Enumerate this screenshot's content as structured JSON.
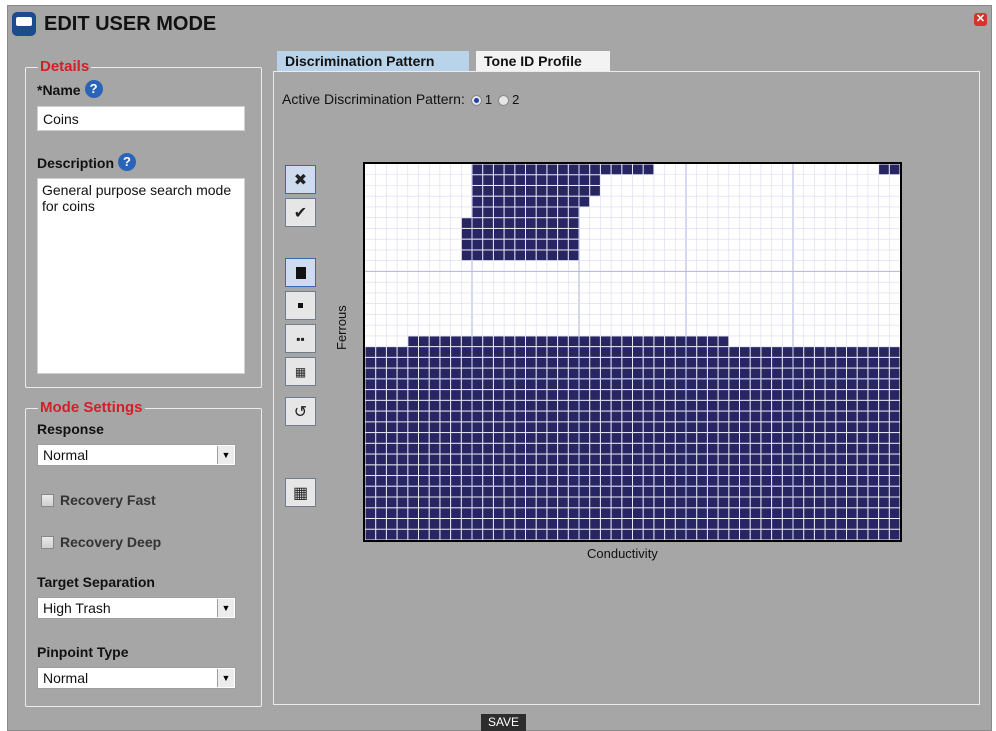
{
  "window": {
    "title": "EDIT USER MODE"
  },
  "details": {
    "legend": "Details",
    "name_label": "*Name",
    "name_value": "Coins",
    "description_label": "Description",
    "description_value": "General purpose search mode for coins"
  },
  "mode_settings": {
    "legend": "Mode Settings",
    "response_label": "Response",
    "response_value": "Normal",
    "recovery_fast": "Recovery Fast",
    "recovery_deep": "Recovery Deep",
    "target_sep_label": "Target Separation",
    "target_sep_value": "High Trash",
    "pinpoint_label": "Pinpoint Type",
    "pinpoint_value": "Normal"
  },
  "tabs": [
    {
      "label": "Discrimination Pattern",
      "active": true
    },
    {
      "label": "Tone ID Profile",
      "active": false
    }
  ],
  "pattern": {
    "active_label": "Active Discrimination Pattern:",
    "option_1": "1",
    "option_2": "2",
    "selected": "1",
    "y_axis": "Ferrous",
    "x_axis": "Conductivity",
    "fill_color": "#272663",
    "grid": {
      "cols": 50,
      "rows": 35,
      "row_fill": [
        [
          [
            10,
            26
          ]
        ],
        [
          [
            10,
            21
          ]
        ],
        [
          [
            10,
            21
          ]
        ],
        [
          [
            10,
            20
          ]
        ],
        [
          [
            10,
            19
          ]
        ],
        [
          [
            9,
            19
          ]
        ],
        [
          [
            9,
            19
          ]
        ],
        [
          [
            9,
            19
          ]
        ],
        [
          [
            9,
            19
          ]
        ],
        [],
        [],
        [],
        [],
        [],
        [],
        [],
        [
          [
            4,
            33
          ]
        ],
        [
          [
            0,
            49
          ]
        ],
        [
          [
            0,
            49
          ]
        ],
        [
          [
            0,
            49
          ]
        ],
        [
          [
            0,
            49
          ]
        ],
        [
          [
            0,
            49
          ]
        ],
        [
          [
            0,
            49
          ]
        ],
        [
          [
            0,
            49
          ]
        ],
        [
          [
            0,
            49
          ]
        ],
        [
          [
            0,
            49
          ]
        ],
        [
          [
            0,
            49
          ]
        ],
        [
          [
            0,
            49
          ]
        ],
        [
          [
            0,
            49
          ]
        ],
        [
          [
            0,
            49
          ]
        ],
        [
          [
            0,
            49
          ]
        ],
        [
          [
            0,
            49
          ]
        ],
        [
          [
            0,
            49
          ]
        ],
        [
          [
            0,
            49
          ]
        ],
        [
          [
            0,
            49
          ]
        ]
      ],
      "top_right_fill": [
        48,
        49
      ]
    }
  },
  "tools": [
    "close-icon",
    "check-icon",
    "paint-brush-icon",
    "small-brush-icon",
    "medium-brush-icon",
    "large-brush-icon",
    "undo-icon",
    "grid-icon"
  ],
  "save_label": "SAVE"
}
